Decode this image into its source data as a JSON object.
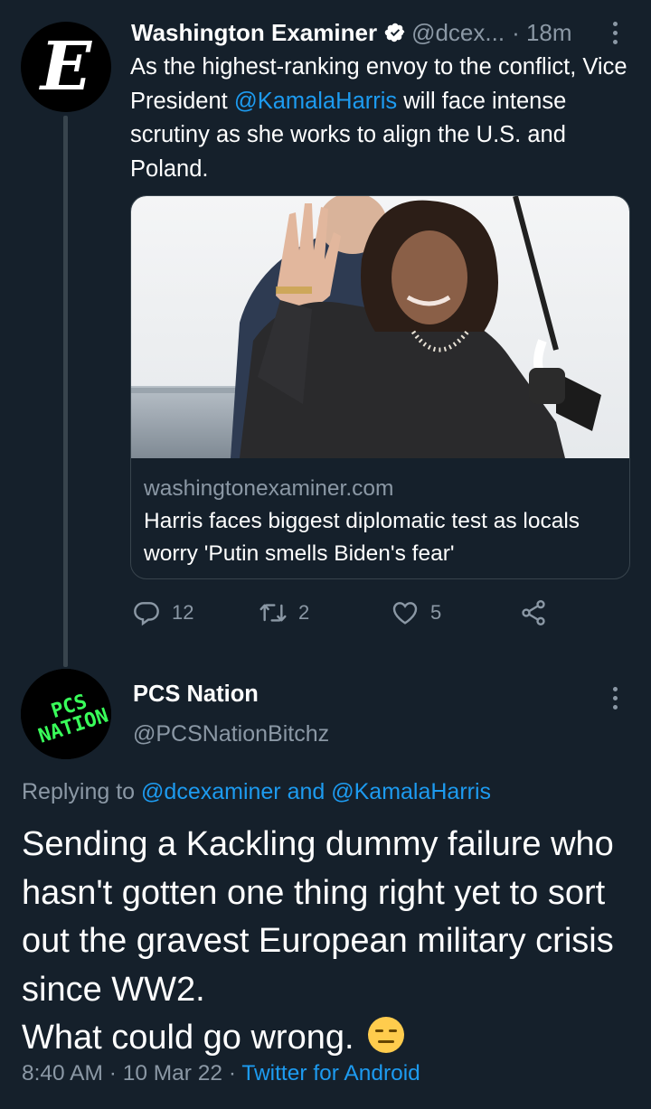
{
  "tweet1": {
    "avatar_letter": "E",
    "name": "Washington Examiner",
    "handle": "@dcex...",
    "time": "· 18m",
    "text_before": "As the highest-ranking envoy to the conflict, Vice President ",
    "mention": "@KamalaHarris",
    "text_after": " will face intense scrutiny as she works to align the U.S. and Poland.",
    "card": {
      "domain": "washingtonexaminer.com",
      "title": "Harris faces biggest diplomatic test as locals worry 'Putin smells Biden's fear'"
    },
    "actions": {
      "replies": "12",
      "retweets": "2",
      "likes": "5"
    }
  },
  "tweet2": {
    "avatar_text": "PCS NATION",
    "name": "PCS Nation",
    "handle": "@PCSNationBitchz",
    "replying_prefix": "Replying to ",
    "replying_to": "@dcexaminer and @KamalaHarris",
    "text": "Sending a Kackling dummy failure who hasn't gotten one thing right yet to sort out the gravest European military crisis since WW2.",
    "text_line2": "What could go wrong.",
    "emoji": "expressionless-face",
    "time": "8:40 AM",
    "date": "10 Mar 22",
    "separator": "·",
    "source": "Twitter for Android"
  },
  "colors": {
    "background": "#15202b",
    "text": "#ffffff",
    "muted": "#8b98a5",
    "link": "#1d9bf0",
    "divider": "#38444d",
    "avatar_text_green": "#39ff5a"
  }
}
